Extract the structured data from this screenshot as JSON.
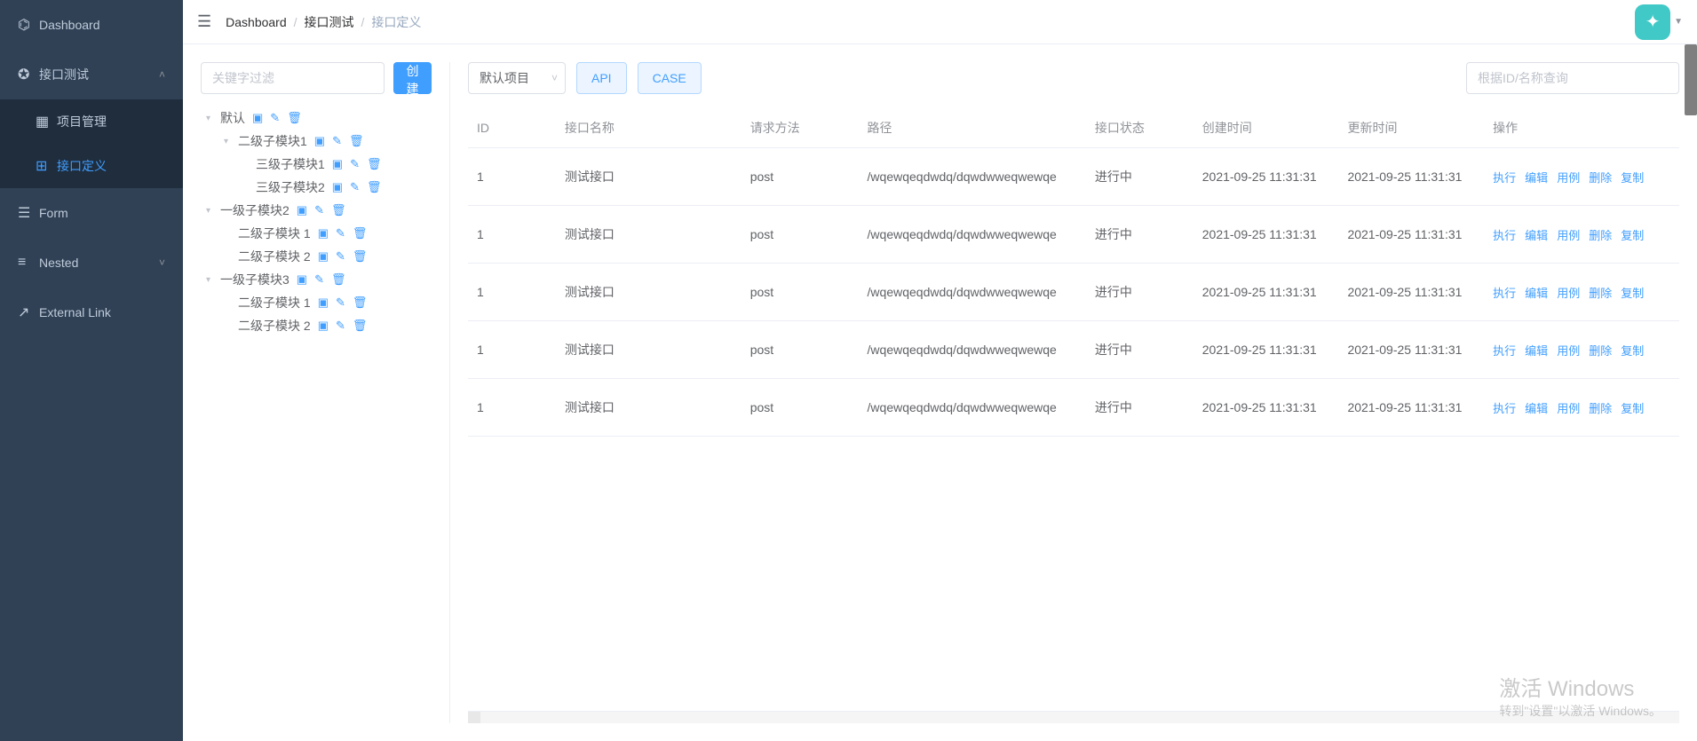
{
  "sidebar": {
    "items": [
      {
        "label": "Dashboard",
        "icon": "⌬"
      },
      {
        "label": "接口测试",
        "icon": "✪",
        "expanded": true,
        "children": [
          {
            "label": "项目管理",
            "icon": "▦"
          },
          {
            "label": "接口定义",
            "icon": "⊞",
            "active": true
          }
        ]
      },
      {
        "label": "Form",
        "icon": "☰"
      },
      {
        "label": "Nested",
        "icon": "≡",
        "expandable": true
      },
      {
        "label": "External Link",
        "icon": "↗"
      }
    ]
  },
  "breadcrumb": [
    "Dashboard",
    "接口测试",
    "接口定义"
  ],
  "leftPanel": {
    "filterPlaceholder": "关键字过滤",
    "createBtn": "创建接口"
  },
  "tree": [
    {
      "label": "默认",
      "level": 1,
      "caret": "down",
      "actions": [
        "folder",
        "edit",
        "delete"
      ]
    },
    {
      "label": "二级子模块1",
      "level": 2,
      "caret": "down",
      "actions": [
        "folder",
        "edit",
        "delete"
      ]
    },
    {
      "label": "三级子模块1",
      "level": 3,
      "caret": "none",
      "actions": [
        "folder",
        "edit",
        "delete"
      ]
    },
    {
      "label": "三级子模块2",
      "level": 3,
      "caret": "none",
      "actions": [
        "folder",
        "edit",
        "delete"
      ]
    },
    {
      "label": "一级子模块2",
      "level": 1,
      "caret": "down",
      "actions": [
        "folder",
        "edit",
        "delete"
      ]
    },
    {
      "label": "二级子模块 1",
      "level": 2,
      "caret": "none",
      "actions": [
        "folder",
        "edit",
        "delete"
      ]
    },
    {
      "label": "二级子模块 2",
      "level": 2,
      "caret": "none",
      "actions": [
        "folder",
        "edit",
        "delete"
      ]
    },
    {
      "label": "一级子模块3",
      "level": 1,
      "caret": "down",
      "actions": [
        "folder",
        "edit",
        "delete"
      ]
    },
    {
      "label": "二级子模块 1",
      "level": 2,
      "caret": "none",
      "actions": [
        "folder",
        "edit",
        "delete"
      ]
    },
    {
      "label": "二级子模块 2",
      "level": 2,
      "caret": "none",
      "actions": [
        "folder",
        "edit",
        "delete"
      ]
    }
  ],
  "toolbar": {
    "projectSelect": "默认项目",
    "apiBtn": "API",
    "caseBtn": "CASE",
    "searchPlaceholder": "根据ID/名称查询"
  },
  "table": {
    "columns": [
      "ID",
      "接口名称",
      "请求方法",
      "路径",
      "接口状态",
      "创建时间",
      "更新时间",
      "操作"
    ],
    "ops": [
      "执行",
      "编辑",
      "用例",
      "删除",
      "复制"
    ],
    "rows": [
      {
        "id": "1",
        "name": "测试接口",
        "method": "post",
        "path": "/wqewqeqdwdq/dqwdwweqwewqe",
        "status": "进行中",
        "created": "2021-09-25 11:31:31",
        "updated": "2021-09-25 11:31:31"
      },
      {
        "id": "1",
        "name": "测试接口",
        "method": "post",
        "path": "/wqewqeqdwdq/dqwdwweqwewqe",
        "status": "进行中",
        "created": "2021-09-25 11:31:31",
        "updated": "2021-09-25 11:31:31"
      },
      {
        "id": "1",
        "name": "测试接口",
        "method": "post",
        "path": "/wqewqeqdwdq/dqwdwweqwewqe",
        "status": "进行中",
        "created": "2021-09-25 11:31:31",
        "updated": "2021-09-25 11:31:31"
      },
      {
        "id": "1",
        "name": "测试接口",
        "method": "post",
        "path": "/wqewqeqdwdq/dqwdwweqwewqe",
        "status": "进行中",
        "created": "2021-09-25 11:31:31",
        "updated": "2021-09-25 11:31:31"
      },
      {
        "id": "1",
        "name": "测试接口",
        "method": "post",
        "path": "/wqewqeqdwdq/dqwdwweqwewqe",
        "status": "进行中",
        "created": "2021-09-25 11:31:31",
        "updated": "2021-09-25 11:31:31"
      }
    ]
  },
  "watermark": {
    "line1": "激活 Windows",
    "line2": "转到\"设置\"以激活 Windows。"
  }
}
